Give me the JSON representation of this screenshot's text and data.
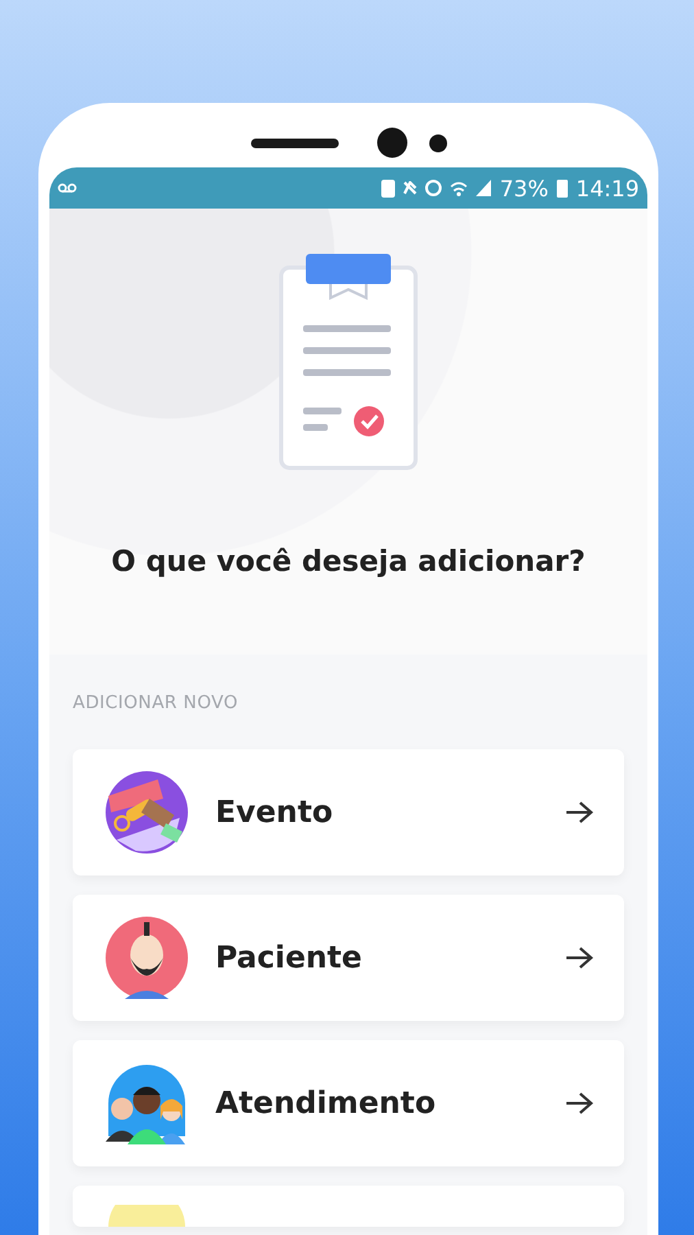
{
  "status_bar": {
    "battery": "73%",
    "time": "14:19"
  },
  "title": "O que você deseja adicionar?",
  "section_label": "ADICIONAR NOVO",
  "items": [
    {
      "kind": "event",
      "label": "Evento"
    },
    {
      "kind": "patient",
      "label": "Paciente"
    },
    {
      "kind": "service",
      "label": "Atendimento"
    },
    {
      "kind": "partial"
    }
  ]
}
